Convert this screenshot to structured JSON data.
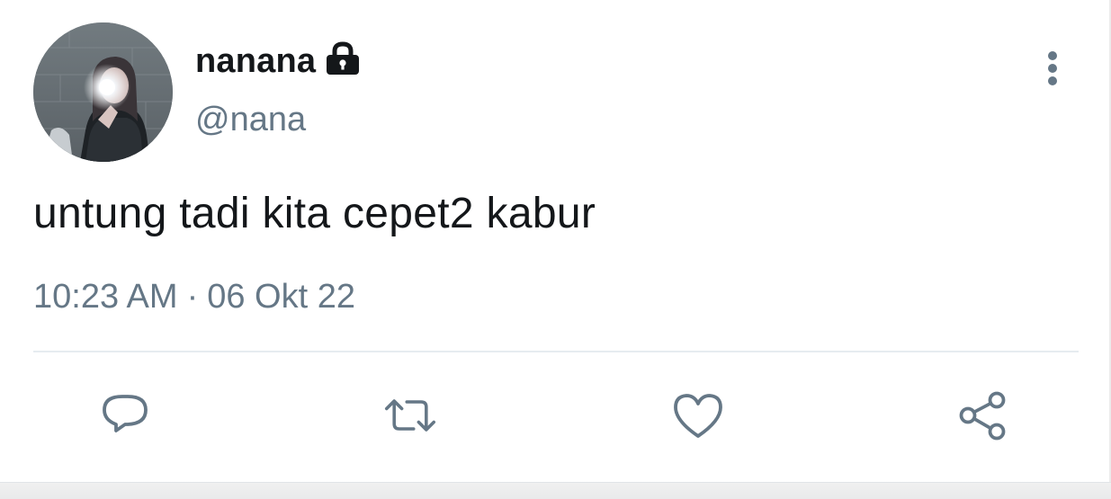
{
  "tweet": {
    "author": {
      "display_name": "nanana",
      "handle": "@nana",
      "protected_icon": "lock-icon",
      "avatar": "profile-photo"
    },
    "text": "untung tadi kita cepet2 kabur",
    "time": "10:23 AM",
    "separator": "·",
    "date": "06 Okt 22",
    "menu_icon": "more-vertical-icon",
    "actions": {
      "reply_icon": "reply-icon",
      "retweet_icon": "retweet-icon",
      "like_icon": "heart-icon",
      "share_icon": "share-icon"
    }
  },
  "colors": {
    "text_primary": "#14171a",
    "text_secondary": "#657786",
    "divider": "#e6ecf0",
    "icon": "#657786"
  }
}
